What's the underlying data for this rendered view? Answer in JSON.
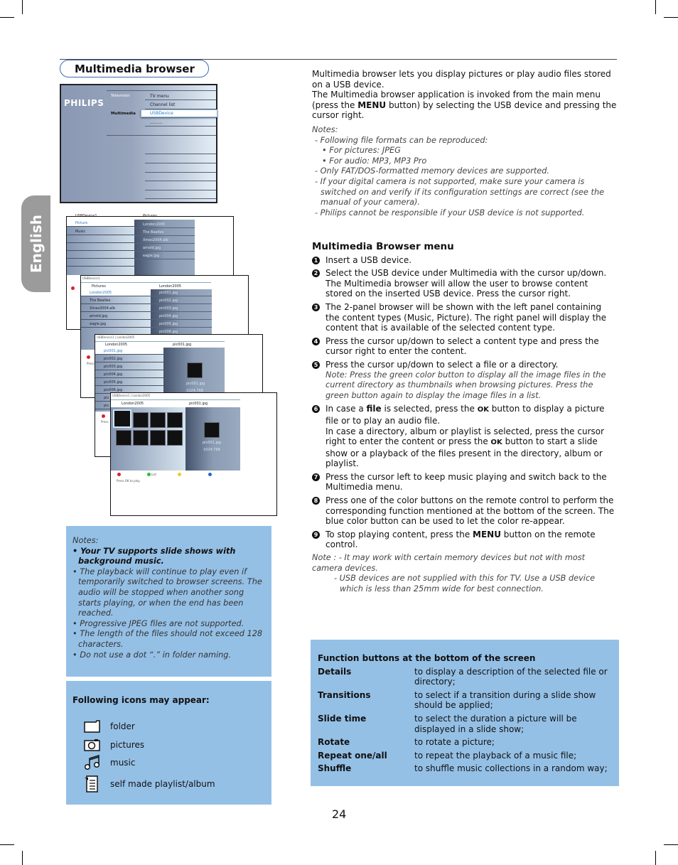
{
  "side_tab": "English",
  "section_title": "Multimedia browser",
  "tv_menu": {
    "logo": "PHILIPS",
    "left": [
      "Television",
      "Multimedia"
    ],
    "right": [
      "TV menu",
      "Channel list",
      "USBDevice",
      "........."
    ]
  },
  "screen_a": {
    "hdr_left": "USBDevice1",
    "hdr_right": "Pictures",
    "left": [
      "Picture",
      "Music"
    ],
    "right": [
      "London2005",
      "The Beatles",
      "Xmas2004.alb",
      "arnold.jpg",
      "eagle.jpg"
    ]
  },
  "screen_b": {
    "path": "USBDevice1",
    "hdr_left": "Pictures",
    "hdr_right": "London2005",
    "left": [
      "London2005",
      "The Beatles",
      "Xmas2004.alb",
      "arnold.jpg",
      "eagle.jpg"
    ],
    "right": [
      "pic001.jpg",
      "pic002.jpg",
      "pic003.jpg",
      "pic004.jpg",
      "pic005.jpg",
      "pic006.jpg"
    ],
    "press": "Press"
  },
  "screen_c": {
    "path": "USBDevice1 | London2005",
    "hdr_left": "London2005",
    "hdr_right": "pic001.jpg",
    "left": [
      "pic001.jpg",
      "pic002.jpg",
      "pic003.jpg",
      "pic004.jpg",
      "pic005.jpg",
      "pic006.jpg",
      "pic",
      "pic"
    ],
    "preview_name": "pic001.jpg",
    "preview_res": "1024:768",
    "press": "Press"
  },
  "screen_d": {
    "path": "USBDevice1 | London2005",
    "hdr_left": "London2005",
    "hdr_right": "pic001.jpg",
    "preview_name": "pic001.jpg",
    "preview_res": "1024:768",
    "green_label": "List",
    "press": "Press OK to play."
  },
  "notes_box": {
    "title": "Notes:",
    "items": [
      "• Your TV supports slide shows with background music.",
      "• The playback will continue to play even if temporarily switched to browser screens. The audio will be stopped when another song starts playing, or when the end has been reached.",
      "• Progressive JPEG files are not supported.",
      "• The length of the files should not exceed 128 characters.",
      "• Do not use a dot “.” in folder naming."
    ]
  },
  "icons_box": {
    "title": "Following icons may appear:",
    "items": [
      {
        "icon": "folder-icon",
        "label": "folder"
      },
      {
        "icon": "camera-icon",
        "label": "pictures"
      },
      {
        "icon": "music-note-icon",
        "label": "music"
      },
      {
        "icon": "playlist-icon",
        "label": "self made playlist/album"
      }
    ]
  },
  "intro": {
    "p1": "Multimedia browser lets you display pictures or play audio files stored on a USB device.",
    "p2a": "The Multimedia browser application is invoked from the main menu (press the ",
    "p2b": "MENU",
    "p2c": " button) by selecting the USB device and pressing the cursor right.",
    "notes_title": "Notes:",
    "notes": [
      "- Following file formats can be reproduced:",
      "• For pictures: JPEG",
      "• For audio: MP3, MP3 Pro",
      "- Only FAT/DOS-formatted memory devices are supported.",
      "- If your digital camera is not supported, make sure your camera is switched on and verify if its configuration settings are correct (see the manual of your camera).",
      "- Philips cannot be responsible if your USB device is not supported."
    ]
  },
  "menu_section": {
    "title": "Multimedia Browser menu",
    "steps": [
      {
        "n": "1",
        "text": "Insert a USB device."
      },
      {
        "n": "2",
        "text": "Select the USB device under Multimedia with the cursor up/down. The Multimedia browser will allow the user to browse content stored on the inserted USB device. Press the cursor right."
      },
      {
        "n": "3",
        "text": "The 2-panel browser will be shown with the left panel containing the content types (Music, Picture). The right panel will display the content that is available of the selected content type."
      },
      {
        "n": "4",
        "text": "Press the cursor up/down to select a content type and press the cursor right to enter the content."
      },
      {
        "n": "5",
        "text": "Press the cursor up/down to select a file or a directory.",
        "note": "Note: Press the green color button to display all the image files in the current directory as thumbnails when browsing pictures. Press the green button again to display the image files in a list."
      },
      {
        "n": "6",
        "a": "In case a ",
        "b": "file",
        "c": " is selected, press the ",
        "d": "OK",
        "e": " button to display a picture file or to play an audio file.",
        "f": "In case a directory, album or playlist is selected, press the cursor right to enter the content or press the ",
        "g": "OK",
        "h": " button to start a slide show or a playback of the files present in the directory, album or playlist."
      },
      {
        "n": "7",
        "text": "Press the cursor left to keep music playing and switch back to the Multimedia menu."
      },
      {
        "n": "8",
        "text": "Press one of the color buttons on the remote control to perform the corresponding function mentioned at the bottom of the screen. The blue color button can be used to let the color re-appear."
      },
      {
        "n": "9",
        "a": "To stop playing content, press the ",
        "b": "MENU",
        "c": " button on the remote control."
      }
    ],
    "note1": "Note : - It may work with certain memory devices but not with most camera devices.",
    "note2": "- USB devices are not supplied with this for TV. Use a USB device which is less than 25mm wide for best connection."
  },
  "function_box": {
    "title": "Function buttons at the bottom of the screen",
    "rows": [
      {
        "name": "Details",
        "desc": "to display a description of the selected file or directory;"
      },
      {
        "name": "Transitions",
        "desc": "to select if a transition during a slide show should be applied;"
      },
      {
        "name": "Slide time",
        "desc": "to select the duration a picture will be displayed in a slide show;"
      },
      {
        "name": "Rotate",
        "desc": "to rotate a picture;"
      },
      {
        "name": "Repeat one/all",
        "desc": "to repeat the playback of a music file;"
      },
      {
        "name": "Shuffle",
        "desc": "to shuffle music collections in a random way;"
      }
    ]
  },
  "page_number": "24",
  "colors": {
    "box_blue": "#95c0e6",
    "tab_gray": "#9b9b9b",
    "pill_border": "#3a6db0"
  }
}
